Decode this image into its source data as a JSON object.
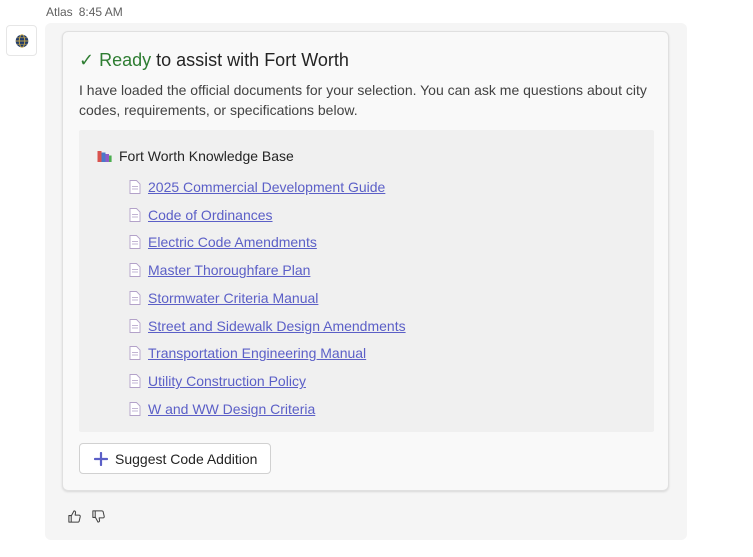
{
  "message": {
    "sender": "Atlas",
    "time": "8:45 AM"
  },
  "card": {
    "title_check": "✓",
    "title_ready": "Ready",
    "title_rest": "to assist with Fort Worth",
    "description": "I have loaded the official documents for your selection. You can ask me questions about city codes, requirements, or specifications below.",
    "knowledge_base": {
      "title": "Fort Worth Knowledge Base",
      "documents": [
        "2025 Commercial Development Guide",
        "Code of Ordinances",
        "Electric Code Amendments",
        "Master Thoroughfare Plan",
        "Stormwater Criteria Manual",
        "Street and Sidewalk Design Amendments",
        "Transportation Engineering Manual",
        "Utility Construction Policy",
        "W and WW Design Criteria"
      ]
    },
    "suggest_button_label": "Suggest Code Addition"
  },
  "colors": {
    "ready_green": "#2e7d32",
    "link_purple": "#5b5fc7",
    "plus_purple": "#5b5fc7"
  },
  "icons": {
    "avatar": "globe-icon",
    "kb": "books-icon",
    "document": "document-icon",
    "suggest": "plus-icon",
    "like": "thumbs-up-icon",
    "dislike": "thumbs-down-icon"
  }
}
